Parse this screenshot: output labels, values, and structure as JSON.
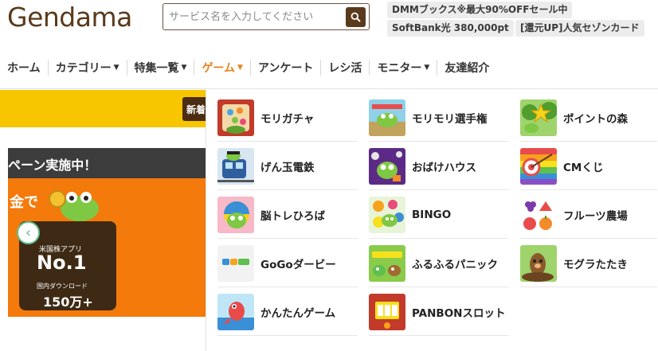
{
  "header": {
    "logo": "Gendama",
    "search_placeholder": "サービス名を入力してください",
    "tags": [
      "DMMブックス※最大90%OFFセール中",
      "SoftBank光 380,000pt",
      "[還元UP]人気セゾンカード"
    ]
  },
  "nav": {
    "items": [
      {
        "label": "ホーム",
        "caret": ""
      },
      {
        "label": "カテゴリー",
        "caret": "▼"
      },
      {
        "label": "特集一覧",
        "caret": "▼"
      },
      {
        "label": "ゲーム",
        "caret": "▼"
      },
      {
        "label": "アンケート",
        "caret": ""
      },
      {
        "label": "レシ活",
        "caret": ""
      },
      {
        "label": "モニター",
        "caret": "▼"
      },
      {
        "label": "友達紹介",
        "caret": ""
      }
    ],
    "active_index": 3
  },
  "background": {
    "new_button": "新着",
    "campaign_text": "ペーン実施中！",
    "banner_text": "金で",
    "app_label": "米国株アプリ",
    "app_rank": "No.1",
    "app_downloads_label": "国内ダウンロード",
    "app_downloads": "150万+"
  },
  "games": [
    {
      "label": "モリガチャ",
      "icon": "morigacha-icon"
    },
    {
      "label": "モリモリ選手権",
      "icon": "morimori-icon"
    },
    {
      "label": "ポイントの森",
      "icon": "point-forest-icon"
    },
    {
      "label": "げん玉電鉄",
      "icon": "train-icon"
    },
    {
      "label": "おばけハウス",
      "icon": "ghost-house-icon"
    },
    {
      "label": "CMくじ",
      "icon": "cm-lottery-icon"
    },
    {
      "label": "脳トレひろば",
      "icon": "brain-icon"
    },
    {
      "label": "BINGO",
      "icon": "bingo-icon"
    },
    {
      "label": "フルーツ農場",
      "icon": "fruit-farm-icon"
    },
    {
      "label": "GoGoダービー",
      "icon": "derby-icon"
    },
    {
      "label": "ふるふるパニック",
      "icon": "furufuru-icon"
    },
    {
      "label": "モグラたたき",
      "icon": "mole-icon"
    },
    {
      "label": "かんたんゲーム",
      "icon": "easy-game-icon"
    },
    {
      "label": "PANBONスロット",
      "icon": "slot-icon"
    }
  ],
  "colors": {
    "brand": "#5a3a1c",
    "nav_active": "#e8821c",
    "band_yellow": "#f7c600",
    "banner_orange": "#f47a0c"
  }
}
